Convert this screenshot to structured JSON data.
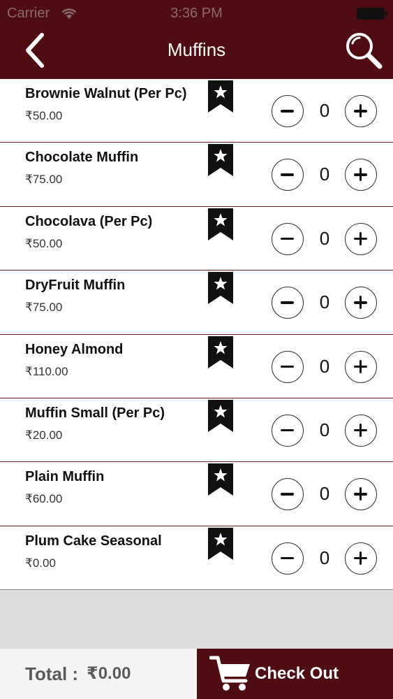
{
  "status_bar": {
    "carrier": "Carrier",
    "time": "3:36 PM"
  },
  "header": {
    "title": "Muffins",
    "back_icon": "chevron-left-icon",
    "search_icon": "search-icon"
  },
  "items": [
    {
      "name": "Brownie Walnut (Per Pc)",
      "price": "₹50.00",
      "qty": "0"
    },
    {
      "name": "Chocolate Muffin",
      "price": "₹75.00",
      "qty": "0"
    },
    {
      "name": "Chocolava (Per Pc)",
      "price": "₹50.00",
      "qty": "0"
    },
    {
      "name": "DryFruit Muffin",
      "price": "₹75.00",
      "qty": "0"
    },
    {
      "name": "Honey Almond",
      "price": "₹110.00",
      "qty": "0"
    },
    {
      "name": "Muffin Small (Per Pc)",
      "price": "₹20.00",
      "qty": "0"
    },
    {
      "name": "Plain Muffin",
      "price": "₹60.00",
      "qty": "0"
    },
    {
      "name": "Plum Cake Seasonal",
      "price": "₹0.00",
      "qty": "0"
    }
  ],
  "footer": {
    "total_label": "Total :",
    "total_value": "₹0.00",
    "checkout_label": "Check Out"
  },
  "colors": {
    "brand": "#4f0d12",
    "background": "#dcdcdc"
  }
}
